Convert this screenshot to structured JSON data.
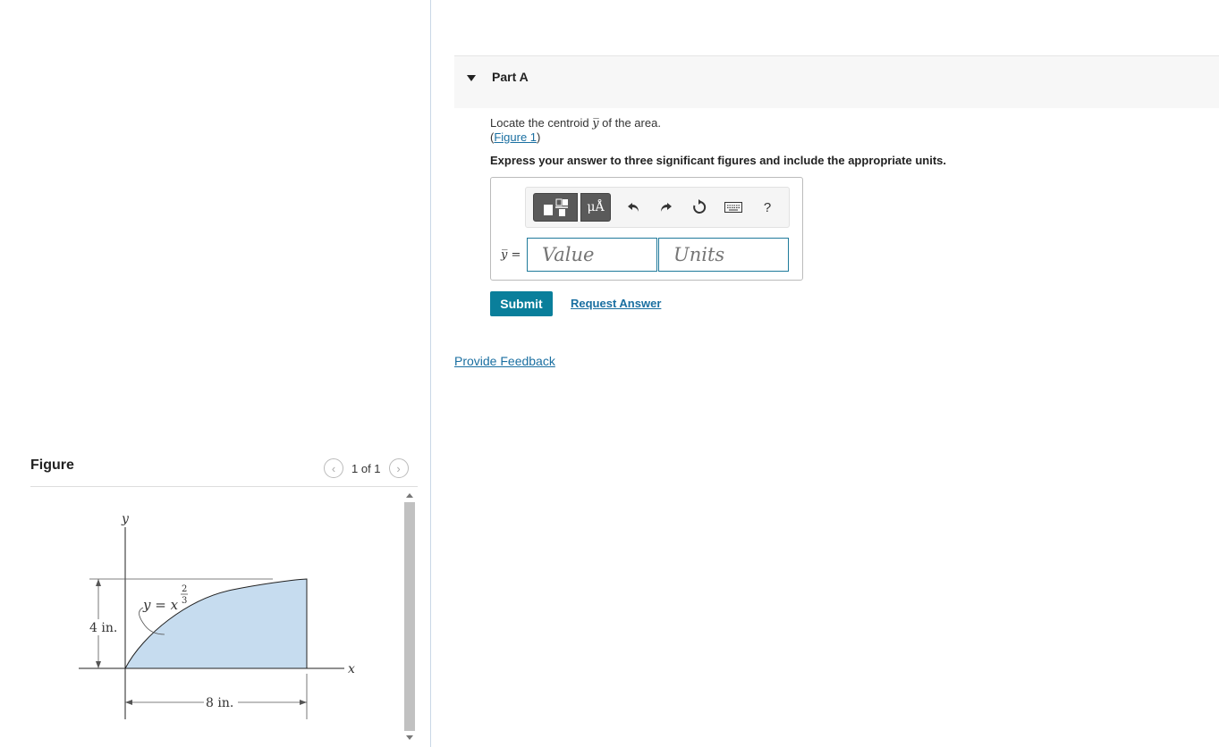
{
  "part": {
    "title": "Part A"
  },
  "question": {
    "prefix": "Locate the centroid ",
    "symbol": "y̅",
    "suffix": " of the area.",
    "figure_link_open": "(",
    "figure_link_text": "Figure 1",
    "figure_link_close": ")",
    "instructions": "Express your answer to three significant figures and include the appropriate units."
  },
  "answer": {
    "variable_label": "y̅ =",
    "value_placeholder": "Value",
    "units_placeholder": "Units",
    "toolbar": {
      "template_icon": "template-icon",
      "units_label": "μÅ",
      "undo_icon": "undo-icon",
      "redo_icon": "redo-icon",
      "reset_icon": "reset-icon",
      "keyboard_icon": "keyboard-icon",
      "help_label": "?"
    }
  },
  "actions": {
    "submit_label": "Submit",
    "request_answer_label": "Request Answer",
    "feedback_label": "Provide Feedback"
  },
  "figure_panel": {
    "title": "Figure",
    "pager_text": "1 of 1",
    "prev_icon": "chevron-left-icon",
    "next_icon": "chevron-right-icon"
  },
  "figure": {
    "y_axis_label": "y",
    "x_axis_label": "x",
    "curve_equation": "y = x",
    "exponent_numerator": "2",
    "exponent_denominator": "3",
    "height_dimension": "4 in.",
    "width_dimension": "8 in.",
    "fill_color": "#c6dcef"
  },
  "colors": {
    "accent": "#0a7f9b",
    "link": "#1a6fa1",
    "input_border": "#1f7a9b"
  }
}
